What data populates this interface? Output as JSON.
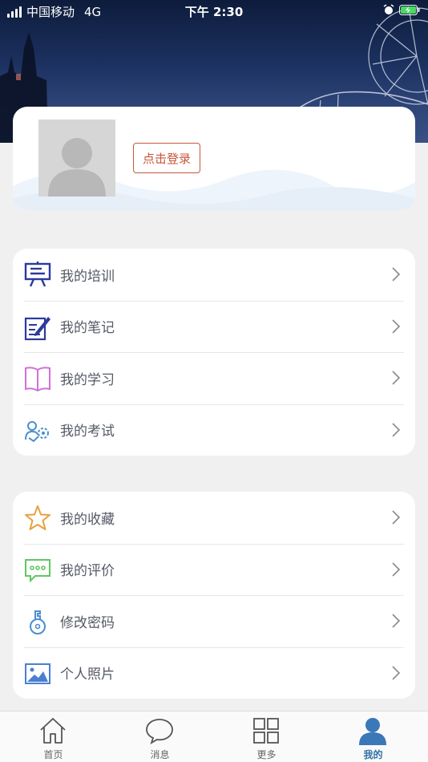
{
  "status_bar": {
    "carrier": "中国移动",
    "network": "4G",
    "time": "下午 2:30"
  },
  "profile": {
    "login_label": "点击登录"
  },
  "menu_groups": [
    {
      "items": [
        {
          "label": "我的培训",
          "icon": "training-board-icon",
          "color": "#2b3a9e"
        },
        {
          "label": "我的笔记",
          "icon": "note-pen-icon",
          "color": "#2b3a9e"
        },
        {
          "label": "我的学习",
          "icon": "open-book-icon",
          "color": "#d070d8"
        },
        {
          "label": "我的考试",
          "icon": "exam-people-gear-icon",
          "color": "#4a8fd0"
        }
      ]
    },
    {
      "items": [
        {
          "label": "我的收藏",
          "icon": "star-icon",
          "color": "#e8a040"
        },
        {
          "label": "我的评价",
          "icon": "comment-icon",
          "color": "#5fc860"
        },
        {
          "label": "修改密码",
          "icon": "key-icon",
          "color": "#4a8fd0"
        },
        {
          "label": "个人照片",
          "icon": "photo-icon",
          "color": "#4a7fd0"
        }
      ]
    }
  ],
  "tabbar": {
    "tabs": [
      {
        "label": "首页",
        "icon": "home-icon",
        "active": false
      },
      {
        "label": "消息",
        "icon": "message-bubble-icon",
        "active": false
      },
      {
        "label": "更多",
        "icon": "grid-icon",
        "active": false
      },
      {
        "label": "我的",
        "icon": "person-icon",
        "active": true
      }
    ]
  },
  "colors": {
    "accent": "#2f6fa8",
    "login_border": "#c8563a",
    "background": "#f0f0f0"
  }
}
